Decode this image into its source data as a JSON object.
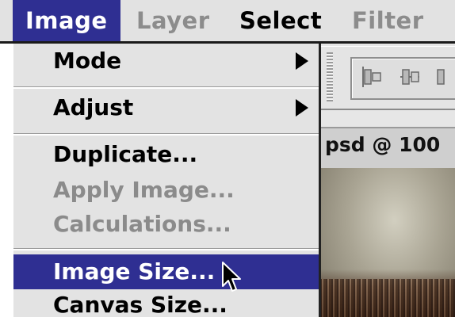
{
  "menubar": {
    "items": [
      {
        "label": "Image",
        "state": "active"
      },
      {
        "label": "Layer",
        "state": "disabled"
      },
      {
        "label": "Select",
        "state": "normal"
      },
      {
        "label": "Filter",
        "state": "disabled"
      }
    ]
  },
  "image_menu": {
    "items": [
      {
        "label": "Mode",
        "submenu": true,
        "enabled": true
      },
      {
        "label": "Adjust",
        "submenu": true,
        "enabled": true
      },
      {
        "label": "Duplicate...",
        "enabled": true
      },
      {
        "label": "Apply Image...",
        "enabled": false
      },
      {
        "label": "Calculations...",
        "enabled": false
      },
      {
        "label": "Image Size...",
        "enabled": true,
        "highlighted": true
      },
      {
        "label": "Canvas Size...",
        "enabled": true
      }
    ]
  },
  "document": {
    "title_fragment": "psd @ 100"
  },
  "colors": {
    "menu_highlight": "#2f2f92",
    "menu_bg": "#e3e3e3",
    "disabled_text": "#8b8b8b"
  },
  "icons": [
    "submenu-arrow-icon",
    "align-left-icon",
    "align-center-icon",
    "mouse-pointer-icon"
  ]
}
